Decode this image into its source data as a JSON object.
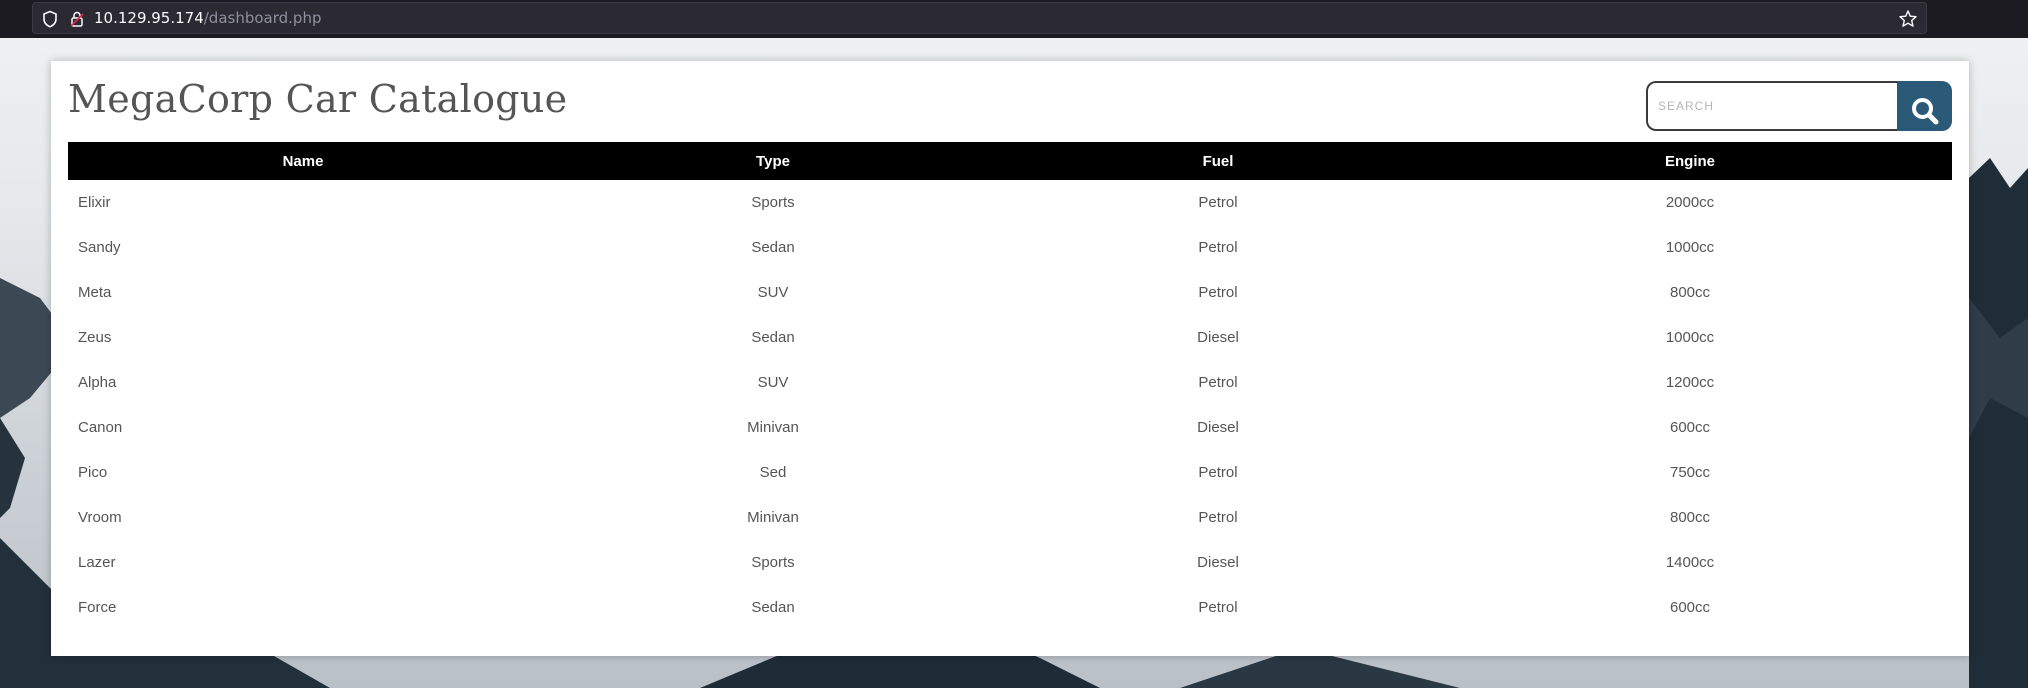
{
  "browser": {
    "url_host": "10.129.95.174",
    "url_path": "/dashboard.php"
  },
  "page": {
    "title": "MegaCorp Car Catalogue",
    "search": {
      "placeholder": "SEARCH",
      "value": ""
    }
  },
  "table": {
    "headers": [
      "Name",
      "Type",
      "Fuel",
      "Engine"
    ],
    "rows": [
      [
        "Elixir",
        "Sports",
        "Petrol",
        "2000cc"
      ],
      [
        "Sandy",
        "Sedan",
        "Petrol",
        "1000cc"
      ],
      [
        "Meta",
        "SUV",
        "Petrol",
        "800cc"
      ],
      [
        "Zeus",
        "Sedan",
        "Diesel",
        "1000cc"
      ],
      [
        "Alpha",
        "SUV",
        "Petrol",
        "1200cc"
      ],
      [
        "Canon",
        "Minivan",
        "Diesel",
        "600cc"
      ],
      [
        "Pico",
        "Sed",
        "Petrol",
        "750cc"
      ],
      [
        "Vroom",
        "Minivan",
        "Petrol",
        "800cc"
      ],
      [
        "Lazer",
        "Sports",
        "Diesel",
        "1400cc"
      ],
      [
        "Force",
        "Sedan",
        "Petrol",
        "600cc"
      ]
    ]
  },
  "colors": {
    "header_bg": "#000000",
    "search_button": "#2b5a78",
    "title_text": "#555555"
  },
  "icons": [
    "shield-icon",
    "lock-icon",
    "star-icon",
    "search-icon"
  ]
}
